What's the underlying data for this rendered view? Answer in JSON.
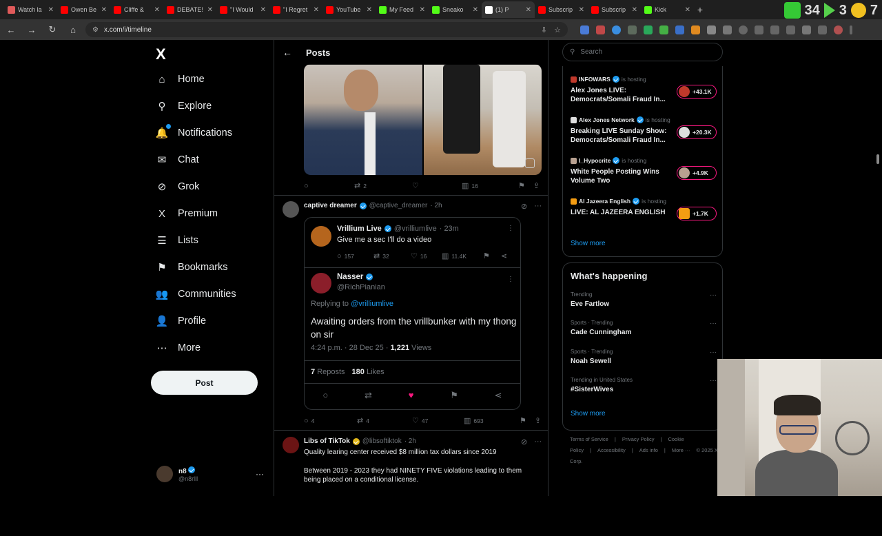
{
  "browser": {
    "tabs": [
      {
        "label": "Watch la",
        "color": "#e05a5a",
        "active": false
      },
      {
        "label": "Owen Be",
        "color": "#ff0000",
        "active": false
      },
      {
        "label": "Cliffe &",
        "color": "#ff0000",
        "active": false
      },
      {
        "label": "DEBATE!",
        "color": "#ff0000",
        "active": false
      },
      {
        "label": "\"I Would",
        "color": "#ff0000",
        "active": false
      },
      {
        "label": "\"I Regret",
        "color": "#ff0000",
        "active": false
      },
      {
        "label": "YouTube",
        "color": "#ff0000",
        "active": false
      },
      {
        "label": "My Feed",
        "color": "#53fc18",
        "active": false
      },
      {
        "label": "Sneako",
        "color": "#53fc18",
        "active": false
      },
      {
        "label": "(1) P",
        "color": "#ffffff",
        "active": true
      },
      {
        "label": "Subscrip",
        "color": "#ff0000",
        "active": false
      },
      {
        "label": "Subscrip",
        "color": "#ff0000",
        "active": false
      },
      {
        "label": "Kick",
        "color": "#53fc18",
        "active": false
      }
    ],
    "overlay_numbers": [
      "34",
      "3",
      "7"
    ],
    "url": "x.com/i/timeline"
  },
  "nav": {
    "items": [
      {
        "label": "Home",
        "icon": "home-icon",
        "glyph": "⌂"
      },
      {
        "label": "Explore",
        "icon": "search-icon",
        "glyph": "⚲"
      },
      {
        "label": "Notifications",
        "icon": "bell-icon",
        "glyph": "🔔"
      },
      {
        "label": "Chat",
        "icon": "mail-icon",
        "glyph": "✉"
      },
      {
        "label": "Grok",
        "icon": "grok-icon",
        "glyph": "⊘"
      },
      {
        "label": "Premium",
        "icon": "x-logo-icon",
        "glyph": "X"
      },
      {
        "label": "Lists",
        "icon": "list-icon",
        "glyph": "☰"
      },
      {
        "label": "Bookmarks",
        "icon": "bookmark-icon",
        "glyph": "⚑"
      },
      {
        "label": "Communities",
        "icon": "people-icon",
        "glyph": "👥"
      },
      {
        "label": "Profile",
        "icon": "person-icon",
        "glyph": "👤"
      },
      {
        "label": "More",
        "icon": "more-circle-icon",
        "glyph": "⋯"
      }
    ],
    "post_label": "Post",
    "user": {
      "name": "n8",
      "handle": "@n8rlll"
    }
  },
  "feed": {
    "title": "Posts",
    "post1": {
      "replies": "",
      "reposts": "2",
      "likes": "",
      "views": "16"
    },
    "post2": {
      "author": "captive dreamer",
      "handle": "@captive_dreamer",
      "time": "· 2h",
      "quoted": {
        "author": "Vrillium Live",
        "handle": "@vrilliumlive",
        "time": "· 23m",
        "text": "Give me a sec I'll do a video",
        "replies": "157",
        "reposts": "32",
        "likes": "16",
        "views": "11.4K"
      },
      "reply": {
        "author": "Nasser",
        "handle": "@RichPianian",
        "replying_prefix": "Replying to",
        "replying_to": "@vrilliumlive",
        "text": "Awaiting orders from the vrillbunker with my thong on sir",
        "time": "4:24 p.m. · 28 Dec 25 ·",
        "views": "1,221",
        "views_label": "Views",
        "reposts": "7",
        "reposts_label": "Reposts",
        "likes": "180",
        "likes_label": "Likes"
      },
      "replies": "4",
      "reposts": "4",
      "likes": "47",
      "views": "693"
    },
    "post3": {
      "author": "Libs of TikTok",
      "handle": "@libsoftiktok",
      "time": "· 2h",
      "line1": "Quality learing center received $8 million tax dollars since 2019",
      "line2": "Between 2019 - 2023 they had NINETY FIVE violations leading to them being placed on a conditional license."
    }
  },
  "right": {
    "search_placeholder": "Search",
    "spaces": [
      {
        "host": "INFOWARS",
        "hosting": "is hosting",
        "title": "Alex Jones LIVE: Democrats/Somali Fraud In...",
        "count": "+43.1K",
        "color": "#c0392b"
      },
      {
        "host": "Alex Jones Network",
        "hosting": "is hosting",
        "title": "Breaking LIVE Sunday Show: Democrats/Somali Fraud In...",
        "count": "+20.3K",
        "color": "#dddddd"
      },
      {
        "host": "I_Hypocrite",
        "hosting": "is hosting",
        "title": "White People Posting Wins Volume Two",
        "count": "+4.9K",
        "color": "#b8a090"
      },
      {
        "host": "Al Jazeera English",
        "hosting": "is hosting",
        "title": "LIVE: AL JAZEERA ENGLISH",
        "count": "+1.7K",
        "color": "#f39c12"
      }
    ],
    "show_more": "Show more",
    "happening_title": "What's happening",
    "trends": [
      {
        "meta": "Trending",
        "name": "Eve Fartlow"
      },
      {
        "meta": "Sports · Trending",
        "name": "Cade Cunningham"
      },
      {
        "meta": "Sports · Trending",
        "name": "Noah Sewell"
      },
      {
        "meta": "Trending in United States",
        "name": "#SisterWives"
      }
    ],
    "footer": [
      "Terms of Service",
      "|",
      "Privacy Policy",
      "|",
      "Cookie Policy",
      "|",
      "Accessibility",
      "|",
      "Ads info",
      "|",
      "More ···",
      "© 2025 X Corp."
    ]
  }
}
